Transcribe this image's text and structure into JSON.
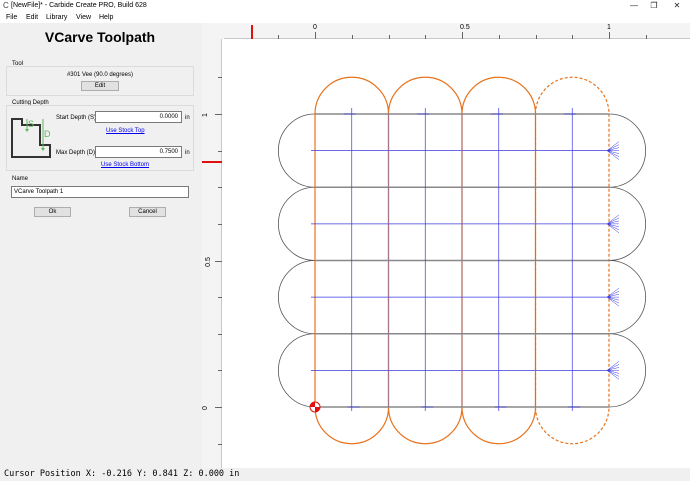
{
  "window": {
    "title": "[NewFile]* - Carbide Create PRO, Build 628",
    "min_glyph": "—",
    "max_glyph": "❐",
    "close_glyph": "✕",
    "app_icon": "carbide-c-icon"
  },
  "menu": {
    "items": [
      "File",
      "Edit",
      "Library",
      "View",
      "Help"
    ]
  },
  "panel": {
    "title": "VCarve Toolpath",
    "tool": {
      "group_label": "Tool",
      "tool_name": "#301 Vee (90.0 degrees)",
      "edit_label": "Edit"
    },
    "cutting_depth": {
      "group_label": "Cutting Depth",
      "diagram_s": "S",
      "diagram_d": "D",
      "start_label": "Start Depth (S)",
      "start_value": "0.0000",
      "start_unit": "in",
      "use_stock_top": "Use Stock Top",
      "max_label": "Max Depth (D)",
      "max_value": "0.7500",
      "max_unit": "in",
      "use_stock_bottom": "Use Stock Bottom"
    },
    "name": {
      "group_label": "Name",
      "value": "VCarve Toolpath 1"
    },
    "ok_label": "Ok",
    "cancel_label": "Cancel"
  },
  "rulers": {
    "top_labels": [
      "0",
      "0.5",
      "1"
    ],
    "left_labels": [
      "1",
      "0.5",
      "0"
    ]
  },
  "status": {
    "cursor_text": "Cursor Position X: -0.216 Y: 0.841 Z: 0.000 in"
  },
  "colors": {
    "orange": "#e8731e",
    "blue": "#3a3ae0",
    "gray_shape": "#555555",
    "selected": "#e01010"
  },
  "design": {
    "grid_columns": 4,
    "grid_rows": 4,
    "units": "in"
  }
}
